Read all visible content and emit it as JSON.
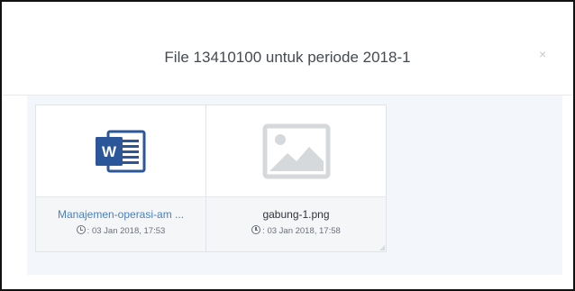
{
  "modal": {
    "title": "File 13410100 untuk periode 2018-1",
    "close_label": "×"
  },
  "files": [
    {
      "name": "Manajemen-operasi-am ...",
      "time": ": 03 Jan 2018, 17:53",
      "icon": "word-document-icon"
    },
    {
      "name": "gabung-1.png",
      "time": ": 03 Jan 2018, 17:58",
      "icon": "image-placeholder-icon"
    }
  ],
  "colors": {
    "word_blue": "#2b579a",
    "link_blue": "#4a7fc1",
    "body_bg": "#f3f6fa"
  }
}
